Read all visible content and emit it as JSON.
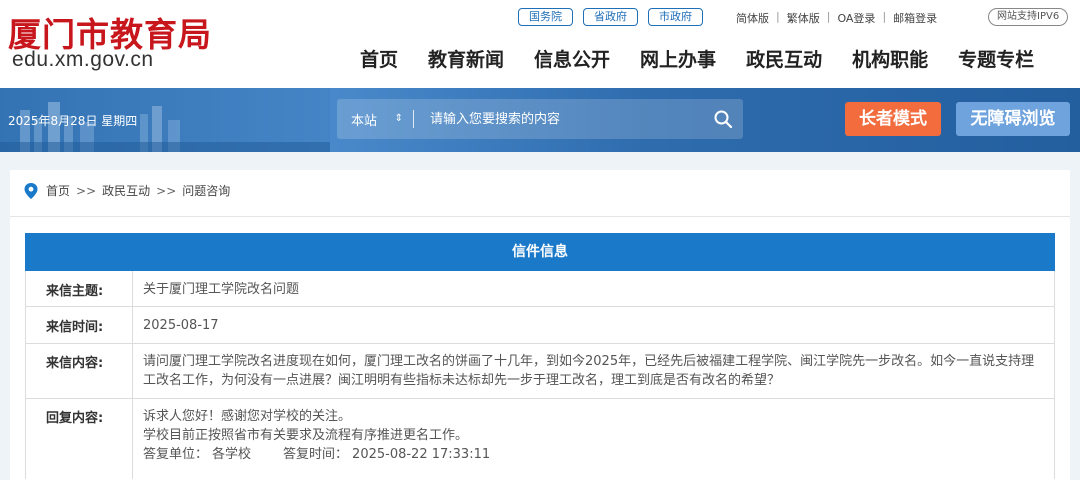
{
  "logo": {
    "title_cn": "厦门市教育局",
    "domain": "edu.xm.gov.cn"
  },
  "gov_links": [
    "国务院",
    "省政府",
    "市政府"
  ],
  "top_links": [
    "简体版",
    "繁体版",
    "OA登录",
    "邮箱登录"
  ],
  "ipv6": "网站支持IPV6",
  "nav": [
    "首页",
    "教育新闻",
    "信息公开",
    "网上办事",
    "政民互动",
    "机构职能",
    "专题专栏"
  ],
  "banner": {
    "date": "2025年8月28日 星期四",
    "search_scope": "本站",
    "search_placeholder": "请输入您要搜索的内容",
    "elder_mode": "长者模式",
    "accessible": "无障碍浏览"
  },
  "breadcrumb": [
    "首页",
    "政民互动",
    "问题咨询"
  ],
  "breadcrumb_separator": ">>",
  "letter": {
    "header": "信件信息",
    "rows": [
      {
        "label": "来信主题:",
        "value": "关于厦门理工学院改名问题"
      },
      {
        "label": "来信时间:",
        "value": "2025-08-17"
      },
      {
        "label": "来信内容:",
        "value": "请问厦门理工学院改名进度现在如何，厦门理工改名的饼画了十几年，到如今2025年，已经先后被福建工程学院、闽江学院先一步改名。如今一直说支持理工改名工作，为何没有一点进展？闽江明明有些指标未达标却先一步于理工改名，理工到底是否有改名的希望？"
      },
      {
        "label": "回复内容:",
        "lines": [
          "诉求人您好！感谢您对学校的关注。",
          "学校目前正按照省市有关要求及流程有序推进更名工作。"
        ],
        "unit_label": "答复单位：",
        "unit": "各学校",
        "time_label": "答复时间：",
        "time": "2025-08-22 17:33:11"
      }
    ]
  },
  "colors": {
    "brand_red": "#c8161d",
    "primary_blue": "#1a79c9",
    "elder_orange": "#f26c3e",
    "accessible_blue": "#6fa3de"
  },
  "icons": {
    "search": "search-icon",
    "location": "location-pin-icon",
    "dropdown": "updown-arrow-icon"
  }
}
